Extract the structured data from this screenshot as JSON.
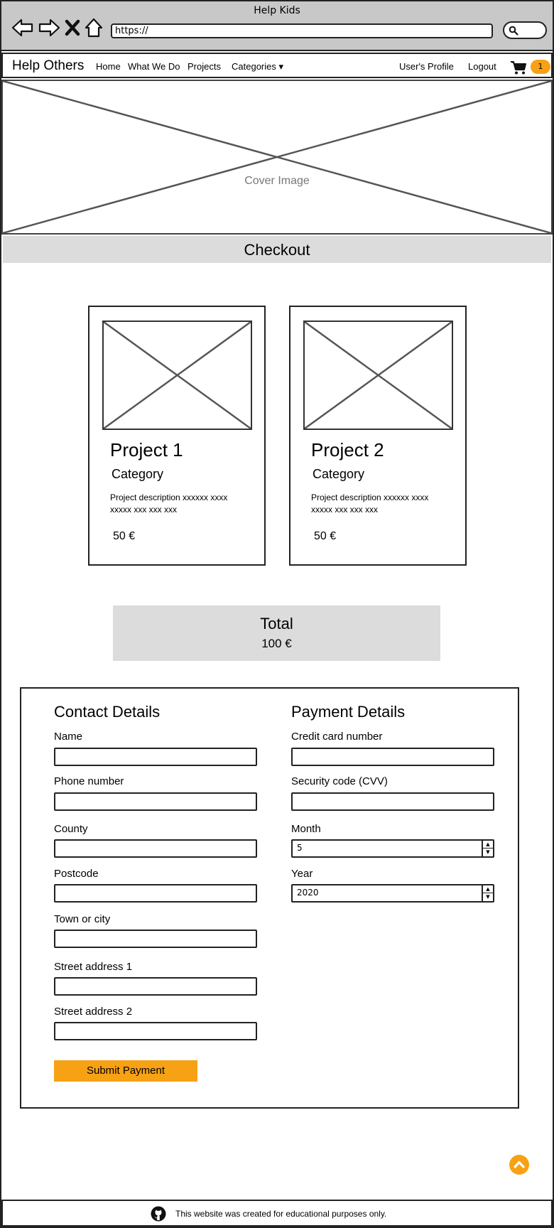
{
  "window": {
    "title": "Help Kids",
    "url": "https://"
  },
  "navbar": {
    "brand": "Help Others",
    "links": [
      "Home",
      "What We Do",
      "Projects",
      "Categories ▾"
    ],
    "profile": "User's Profile",
    "logout": "Logout",
    "cart_count": "1"
  },
  "cover": {
    "label": "Cover Image"
  },
  "checkout": {
    "title": "Checkout"
  },
  "projects": [
    {
      "title": "Project 1",
      "category": "Category",
      "description": "Project description xxxxxx xxxx xxxxx xxx xxx xxx",
      "price": "50 €"
    },
    {
      "title": "Project 2",
      "category": "Category",
      "description": "Project description xxxxxx xxxx xxxxx xxx xxx xxx",
      "price": "50 €"
    }
  ],
  "total": {
    "label": "Total",
    "value": "100 €"
  },
  "contact": {
    "title": "Contact Details",
    "fields": [
      "Name",
      "Phone number",
      "County",
      "Postcode",
      "Town or city",
      "Street address 1",
      "Street address 2"
    ]
  },
  "payment": {
    "title": "Payment Details",
    "card_label": "Credit card number",
    "cvv_label": "Security code (CVV)",
    "month_label": "Month",
    "month_value": "5",
    "year_label": "Year",
    "year_value": "2020"
  },
  "submit_label": "Submit Payment",
  "footer": {
    "text": "This website was created for educational purposes only."
  },
  "colors": {
    "accent": "#f7a114",
    "band": "#dcdcdc",
    "chrome": "#c8c8c8"
  }
}
